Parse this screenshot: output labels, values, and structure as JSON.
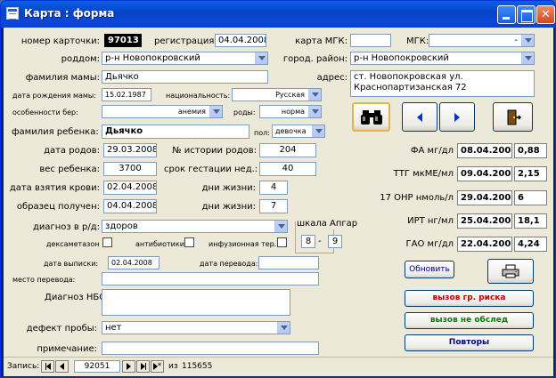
{
  "window": {
    "title": "Карта : форма",
    "close_glyph": "✕"
  },
  "labels": {
    "card_number": "номер карточки:",
    "registration": "регистрация",
    "mgk_card": "карта МГК:",
    "mgk": "МГК:",
    "maternity": "роддом:",
    "city_district": "город. район:",
    "mother_surname": "фамилия мамы:",
    "address": "адрес:",
    "mother_dob": "дата рождения мамы:",
    "nationality": "национальность:",
    "pregnancy_features": "особенности бер:",
    "births": "роды:",
    "child_surname": "фамилия ребенка:",
    "sex": "пол:",
    "birth_date": "дата родов:",
    "history_number": "№ истории родов:",
    "child_weight": "вес ребенка:",
    "gestation_weeks": "срок гестации нед.:",
    "blood_date": "дата взятия крови:",
    "life_days_1": "дни жизни:",
    "sample_received": "образец получен:",
    "life_days_2": "дни жизни:",
    "diagnosis_maternity": "диагноз в р/д:",
    "apgar": "шкала Апгар",
    "dexamethasone": "дексаметазон",
    "antibiotics": "антибиотики",
    "infusion": "инфузионная тер.",
    "discharge_date": "дата выписки:",
    "transfer_date": "дата перевода:",
    "transfer_place": "место перевода:",
    "nbo_diagnosis": "Диагноз НБО",
    "sample_defect": "дефект пробы:",
    "note": "примечание:",
    "record": "Запись:",
    "of": "из"
  },
  "values": {
    "card_number": "97013",
    "registration": "04.04.2008",
    "mgk_card": "",
    "mgk": "-",
    "maternity": "р-н Новопокровский",
    "city_district": "р-н Новопокровский",
    "mother_surname": "Дьячко",
    "address": "ст. Новопокровская ул.\nКраснопартизанская 72",
    "mother_dob": "15.02.1987",
    "nationality": "Русская",
    "pregnancy_features": "анемия",
    "births": "норма",
    "child_surname": "Дьячко",
    "sex": "девочка",
    "birth_date": "29.03.2008",
    "history_number": "204",
    "child_weight": "3700",
    "gestation_weeks": "40",
    "blood_date": "02.04.2008",
    "life_days_1": "4",
    "sample_received": "04.04.2008",
    "life_days_2": "7",
    "diagnosis_maternity": "здоров",
    "apgar_1": "8",
    "apgar_sep": "-",
    "apgar_2": "9",
    "discharge_date": "02.04.2008",
    "transfer_date": "",
    "transfer_place": "",
    "nbo_diagnosis": "",
    "sample_defect": "нет",
    "note": ""
  },
  "results": [
    {
      "label": "ФА мг/дл",
      "date": "08.04.2008",
      "value": "0,88"
    },
    {
      "label": "ТТГ мкМЕ/мл",
      "date": "09.04.2008",
      "value": "2,15"
    },
    {
      "label": "17 ОНР нмоль/л",
      "date": "29.04.2008",
      "value": "6"
    },
    {
      "label": "ИРТ нг/мл",
      "date": "25.04.2008",
      "value": "18,1"
    },
    {
      "label": "ГАО мг/дл",
      "date": "22.04.2008",
      "value": "4,24"
    }
  ],
  "buttons": {
    "update": "Обновить",
    "call_risk": "вызов гр. риска",
    "call_not_examined": "вызов не обслед",
    "repeats": "Повторы"
  },
  "nav": {
    "current": "92051",
    "total": "115655"
  },
  "icons": {
    "find": "binoculars-icon",
    "prev": "triangle-left-icon",
    "next": "triangle-right-icon",
    "exit": "door-exit-icon",
    "print": "printer-icon"
  }
}
